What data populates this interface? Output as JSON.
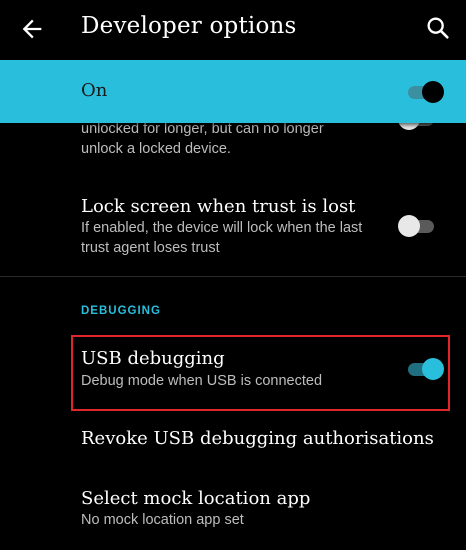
{
  "appbar": {
    "title": "Developer options"
  },
  "master": {
    "label": "On"
  },
  "rows": {
    "stay_unlocked": {
      "sub_line1": "unlocked for longer, but can no longer",
      "sub_line2": "unlock a locked device."
    },
    "lock_screen": {
      "title": "Lock screen when trust is lost",
      "sub_line1": "If enabled, the device will lock when the last",
      "sub_line2": "trust agent loses trust"
    },
    "usb_debugging": {
      "title": "USB debugging",
      "sub": "Debug mode when USB is connected"
    },
    "revoke": {
      "title": "Revoke USB debugging authorisations"
    },
    "mock_location": {
      "title": "Select mock location app",
      "sub": "No mock location app set"
    }
  },
  "sections": {
    "debugging": "DEBUGGING"
  },
  "colors": {
    "accent": "#29bfdc",
    "highlight_border": "#e0262b",
    "background": "#000000"
  },
  "states": {
    "master_on": true,
    "stay_unlocked_on": false,
    "lock_screen_on": false,
    "usb_debugging_on": true
  }
}
